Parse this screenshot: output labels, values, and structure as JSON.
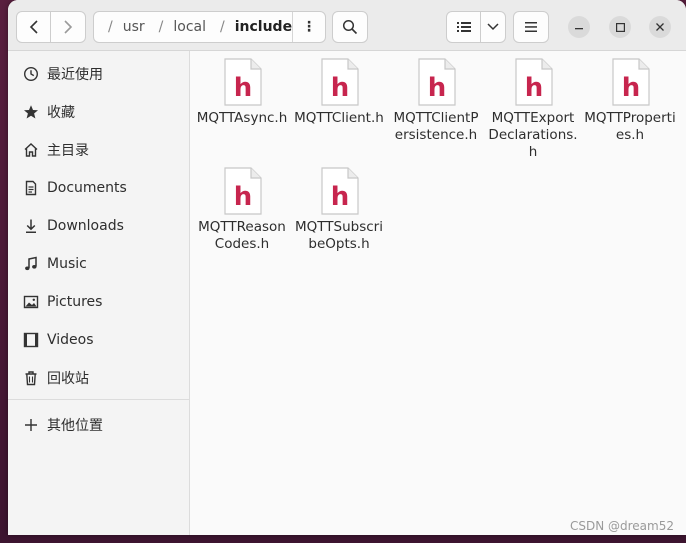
{
  "pathbar": {
    "segments": [
      "usr",
      "local",
      "include"
    ],
    "menu_label": "⋮"
  },
  "sidebar": {
    "items": [
      {
        "label": "最近使用",
        "icon": "clock-icon"
      },
      {
        "label": "收藏",
        "icon": "star-icon"
      },
      {
        "label": "主目录",
        "icon": "home-icon"
      },
      {
        "label": "Documents",
        "icon": "document-icon"
      },
      {
        "label": "Downloads",
        "icon": "download-icon"
      },
      {
        "label": "Music",
        "icon": "music-icon"
      },
      {
        "label": "Pictures",
        "icon": "picture-icon"
      },
      {
        "label": "Videos",
        "icon": "video-icon"
      },
      {
        "label": "回收站",
        "icon": "trash-icon"
      },
      {
        "label": "其他位置",
        "icon": "plus-icon"
      }
    ]
  },
  "files": [
    {
      "name": "MQTTAsync.h",
      "icon_letter": "h"
    },
    {
      "name": "MQTTClient.h",
      "icon_letter": "h"
    },
    {
      "name": "MQTTClientPersistence.h",
      "icon_letter": "h"
    },
    {
      "name": "MQTTExportDeclarations.h",
      "icon_letter": "h"
    },
    {
      "name": "MQTTProperties.h",
      "icon_letter": "h"
    },
    {
      "name": "MQTTReasonCodes.h",
      "icon_letter": "h"
    },
    {
      "name": "MQTTSubscribeOpts.h",
      "icon_letter": "h"
    }
  ],
  "watermark": "CSDN @dream52",
  "colors": {
    "header_icon_accent": "#c7254e",
    "header_bg": "#ebebeb",
    "sidebar_bg": "#f4f4f4"
  }
}
